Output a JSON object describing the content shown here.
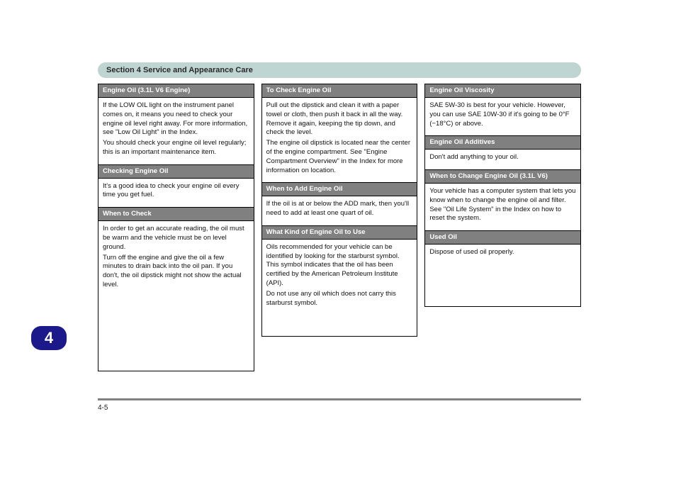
{
  "section_tab": "4",
  "section_header": "Section 4 Service and Appearance Care",
  "footer": {
    "left": "4-5",
    "right": ""
  },
  "columns": [
    {
      "blocks": [
        {
          "heading": "Engine Oil (3.1L V6 Engine)",
          "paragraphs": [
            "If the LOW OIL light on the instrument panel comes on, it means you need to check your engine oil level right away. For more information, see \"Low Oil Light\" in the Index.",
            "You should check your engine oil level regularly; this is an important maintenance item."
          ]
        },
        {
          "heading": "Checking Engine Oil",
          "paragraphs": [
            "It's a good idea to check your engine oil every time you get fuel."
          ]
        },
        {
          "heading": "When to Check",
          "paragraphs": [
            "In order to get an accurate reading, the oil must be warm and the vehicle must be on level ground.",
            "Turn off the engine and give the oil a few minutes to drain back into the oil pan. If you don't, the oil dipstick might not show the actual level."
          ]
        }
      ]
    },
    {
      "blocks": [
        {
          "heading": "To Check Engine Oil",
          "paragraphs": [
            "Pull out the dipstick and clean it with a paper towel or cloth, then push it back in all the way. Remove it again, keeping the tip down, and check the level.",
            "The engine oil dipstick is located near the center of the engine compartment. See \"Engine Compartment Overview\" in the Index for more information on location."
          ]
        },
        {
          "heading": "When to Add Engine Oil",
          "paragraphs": [
            "If the oil is at or below the ADD mark, then you'll need to add at least one quart of oil."
          ]
        },
        {
          "heading": "What Kind of Engine Oil to Use",
          "paragraphs": [
            "Oils recommended for your vehicle can be identified by looking for the starburst symbol. This symbol indicates that the oil has been certified by the American Petroleum Institute (API).",
            "Do not use any oil which does not carry this starburst symbol."
          ]
        }
      ]
    },
    {
      "blocks": [
        {
          "heading": "Engine Oil Viscosity",
          "paragraphs": [
            "SAE 5W-30 is best for your vehicle. However, you can use SAE 10W-30 if it's going to be 0°F (−18°C) or above."
          ]
        },
        {
          "heading": "Engine Oil Additives",
          "paragraphs": [
            "Don't add anything to your oil."
          ]
        },
        {
          "heading": "When to Change Engine Oil (3.1L V6)",
          "paragraphs": [
            "Your vehicle has a computer system that lets you know when to change the engine oil and filter. See \"Oil Life System\" in the Index on how to reset the system."
          ]
        },
        {
          "heading": "Used Oil",
          "paragraphs": [
            "Dispose of used oil properly."
          ]
        }
      ]
    }
  ]
}
